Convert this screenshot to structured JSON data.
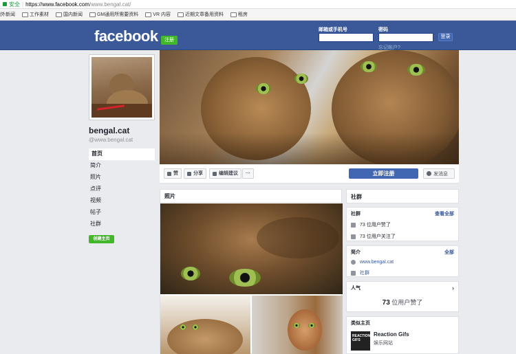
{
  "browser": {
    "secure_label": "安全",
    "url_main": "https://www.facebook.com",
    "url_path": "/www.bengal.cat/",
    "bookmarks": [
      "国外新闻",
      "工作素材",
      "国内新闻",
      "GM通用所需要资料",
      "VR 内容",
      "近期文章备用资料",
      "租房"
    ]
  },
  "header": {
    "logo": "facebook",
    "register_label": "注册",
    "email_label": "邮箱或手机号",
    "password_label": "密码",
    "login_label": "登录",
    "forgot_label": "忘记帐户?"
  },
  "profile": {
    "name": "bengal.cat",
    "handle": "@www.bengal.cat",
    "nav": [
      "首页",
      "简介",
      "照片",
      "点评",
      "视频",
      "帖子",
      "社群"
    ],
    "create_page_label": "创建主页"
  },
  "actions": {
    "like": "赞",
    "share": "分享",
    "suggest": "编辑建议",
    "more": "···",
    "signup": "立即注册",
    "message": "发消息"
  },
  "photos": {
    "title": "照片"
  },
  "sidebar": {
    "community_header": "社群",
    "community_sub": "社群",
    "see_all": "查看全部",
    "likes_text": "73 位用户赞了",
    "follows_text": "73 位用户关注了",
    "about_sub": "简介",
    "about_all": "全部",
    "website": "www.bengal.cat",
    "category": "社群",
    "popularity_sub": "人气",
    "big_like_count": "73",
    "big_like_text": " 位用户赞了",
    "similar_sub": "类似主页",
    "rec_name": "Reaction Gifs",
    "rec_category": "娱乐网站",
    "rec_thumb": "REACTION GIFS"
  }
}
